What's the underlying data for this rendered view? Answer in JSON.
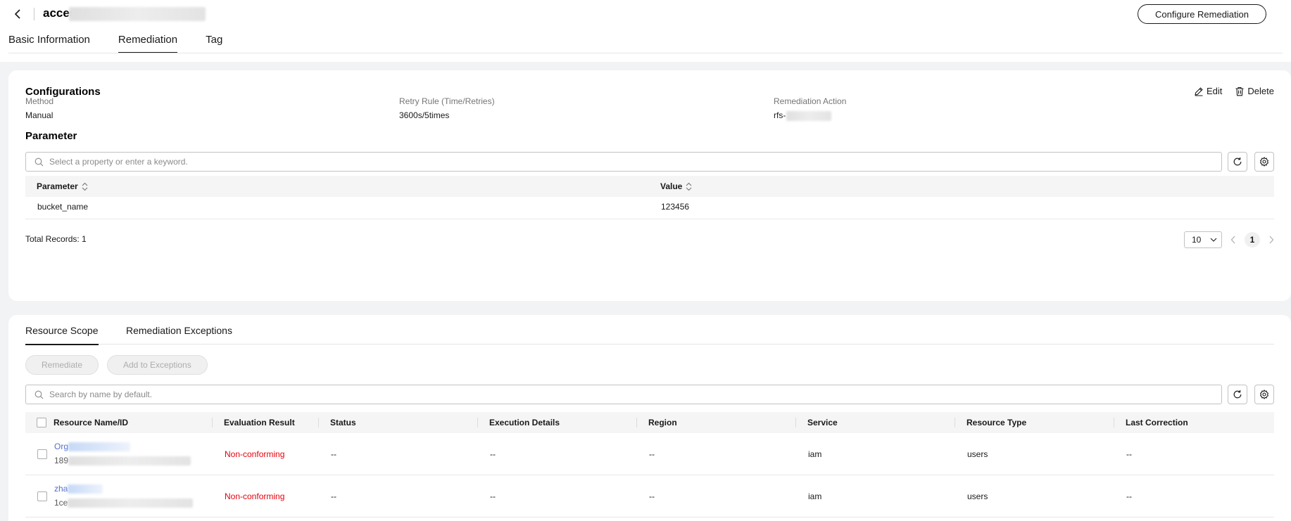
{
  "header": {
    "title_visible": "acces",
    "configure_button": "Configure Remediation"
  },
  "top_tabs": [
    {
      "label": "Basic Information",
      "active": false
    },
    {
      "label": "Remediation",
      "active": true
    },
    {
      "label": "Tag",
      "active": false
    }
  ],
  "configurations": {
    "title": "Configurations",
    "edit_label": "Edit",
    "delete_label": "Delete",
    "fields": [
      {
        "label": "Method",
        "value": "Manual"
      },
      {
        "label": "Retry Rule (Time/Retries)",
        "value": "3600s/5times"
      },
      {
        "label": "Remediation Action",
        "value": "rfs-"
      }
    ]
  },
  "parameter": {
    "title": "Parameter",
    "search_placeholder": "Select a property or enter a keyword.",
    "columns": [
      "Parameter",
      "Value"
    ],
    "rows": [
      {
        "parameter": "bucket_name",
        "value": "123456"
      }
    ],
    "total_records": "Total Records: 1",
    "page_size": "10",
    "current_page": "1"
  },
  "resource_tabs": [
    {
      "label": "Resource Scope",
      "active": true
    },
    {
      "label": "Remediation Exceptions",
      "active": false
    }
  ],
  "resource_actions": {
    "remediate": "Remediate",
    "add_exceptions": "Add to Exceptions"
  },
  "resource_table": {
    "search_placeholder": "Search by name by default.",
    "columns": [
      "Resource Name/ID",
      "Evaluation Result",
      "Status",
      "Execution Details",
      "Region",
      "Service",
      "Resource Type",
      "Last Correction"
    ],
    "rows": [
      {
        "name": "Org",
        "id": "189",
        "evaluation": "Non-conforming",
        "status": "--",
        "execution": "--",
        "region": "--",
        "service": "iam",
        "type": "users",
        "last": "--"
      },
      {
        "name": "zha",
        "id": "1ce",
        "evaluation": "Non-conforming",
        "status": "--",
        "execution": "--",
        "region": "--",
        "service": "iam",
        "type": "users",
        "last": "--"
      }
    ]
  },
  "colors": {
    "accent": "#191919",
    "link": "#526ecc",
    "danger": "#e7000b"
  }
}
